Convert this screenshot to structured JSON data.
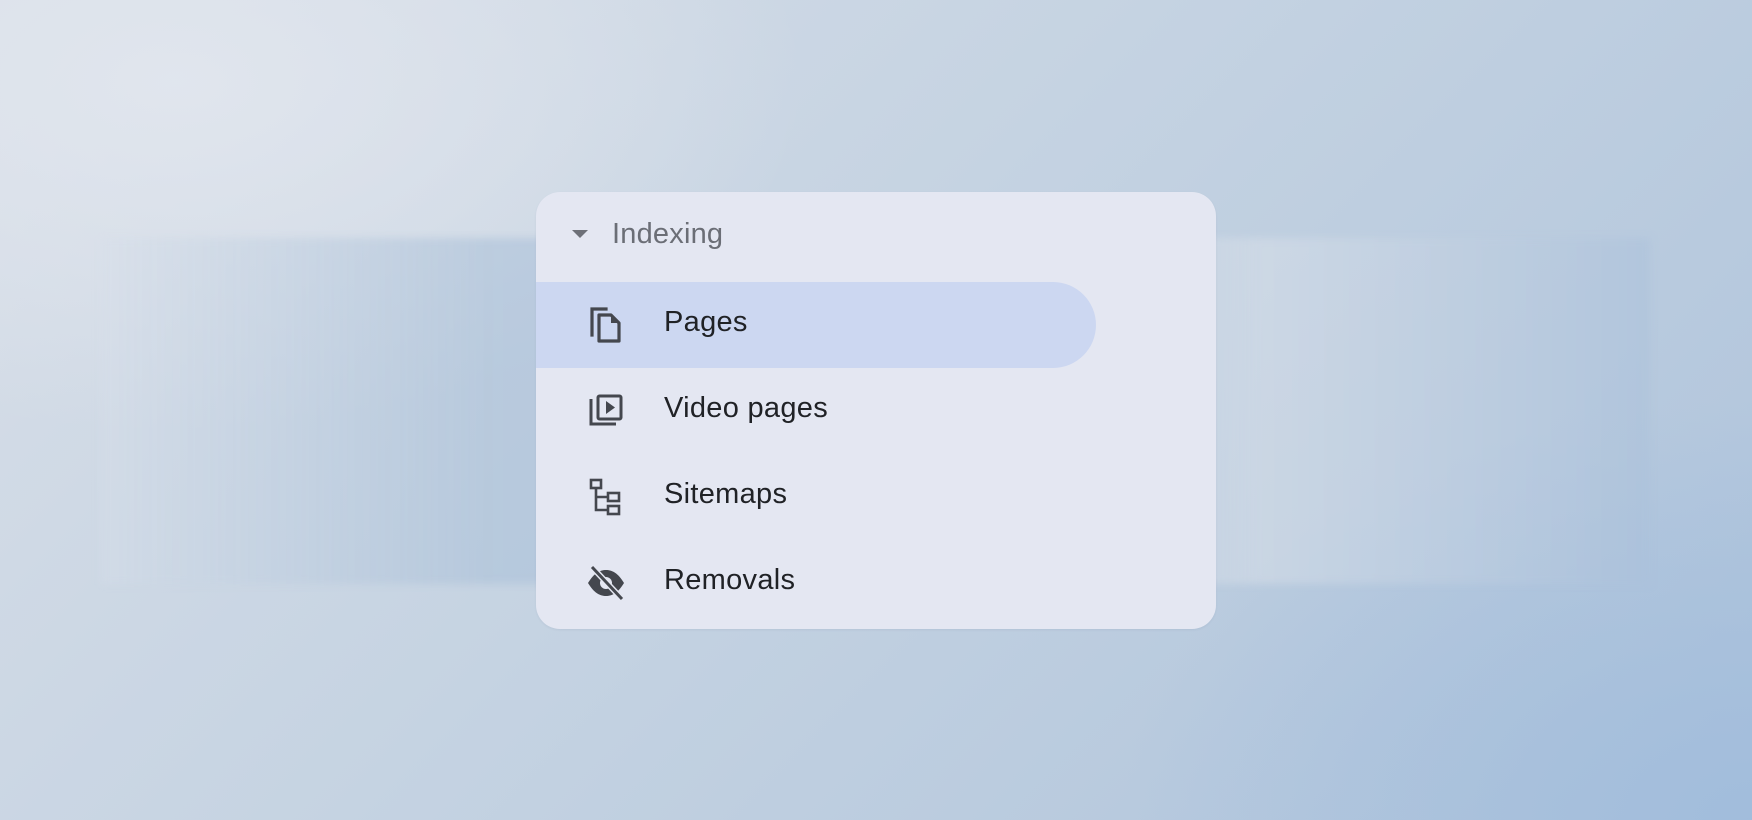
{
  "section": {
    "title": "Indexing",
    "expanded": true,
    "caret_icon": "caret-down-icon"
  },
  "items": [
    {
      "label": "Pages",
      "icon": "pages-icon",
      "active": true
    },
    {
      "label": "Video pages",
      "icon": "video-pages-icon",
      "active": false
    },
    {
      "label": "Sitemaps",
      "icon": "sitemap-icon",
      "active": false
    },
    {
      "label": "Removals",
      "icon": "visibility-off-icon",
      "active": false
    }
  ],
  "colors": {
    "card_background": "#e4e7f2",
    "active_highlight": "#ccd7f1",
    "header_text": "#6b6e76",
    "item_text": "#202226",
    "icon": "#44474e"
  }
}
